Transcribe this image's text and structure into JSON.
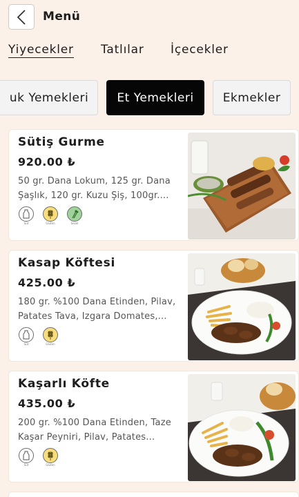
{
  "header": {
    "title": "Menü",
    "back_icon": "chevron-left-icon"
  },
  "tabs": [
    {
      "label": "Yiyecekler",
      "active": true
    },
    {
      "label": "Tatlılar",
      "active": false
    },
    {
      "label": "İçecekler",
      "active": false
    }
  ],
  "categories": [
    {
      "label": "Sıcak Yemekleri",
      "visible_text": "uk Yemekleri",
      "active": false
    },
    {
      "label": "Et Yemekleri",
      "active": true
    },
    {
      "label": "Ekmekler",
      "active": false
    }
  ],
  "items": [
    {
      "name": "Sütiş Gurme",
      "price": "920.00 ₺",
      "description": "50 gr. Dana Lokum, 125 gr. Dana Şaşlık, 120 gr. Kuzu Şiş, 100gr....",
      "badges": [
        {
          "icon": "milk-bottle-icon",
          "label": "Süt"
        },
        {
          "icon": "wheat-icon",
          "label": "Gluten"
        },
        {
          "icon": "celery-icon",
          "label": "Sezel"
        }
      ]
    },
    {
      "name": "Kasap Köftesi",
      "price": "425.00 ₺",
      "description": "180 gr. %100 Dana Etinden, Pilav, Patates Tava, Izgara Domates,...",
      "badges": [
        {
          "icon": "milk-bottle-icon",
          "label": "Süt"
        },
        {
          "icon": "wheat-icon",
          "label": "Gluten"
        }
      ]
    },
    {
      "name": "Kaşarlı Köfte",
      "price": "435.00 ₺",
      "description": "200 gr. %100 Dana Etinden, Taze Kaşar Peyniri, Pilav, Patates...",
      "badges": [
        {
          "icon": "milk-bottle-icon",
          "label": "Süt"
        },
        {
          "icon": "wheat-icon",
          "label": "Gluten"
        }
      ]
    }
  ],
  "colors": {
    "background": "#fbf1e8",
    "active_chip": "#060606",
    "card": "#ffffff",
    "gluten_badge": "#f7dd7c",
    "celery_badge": "#9fd39a"
  }
}
